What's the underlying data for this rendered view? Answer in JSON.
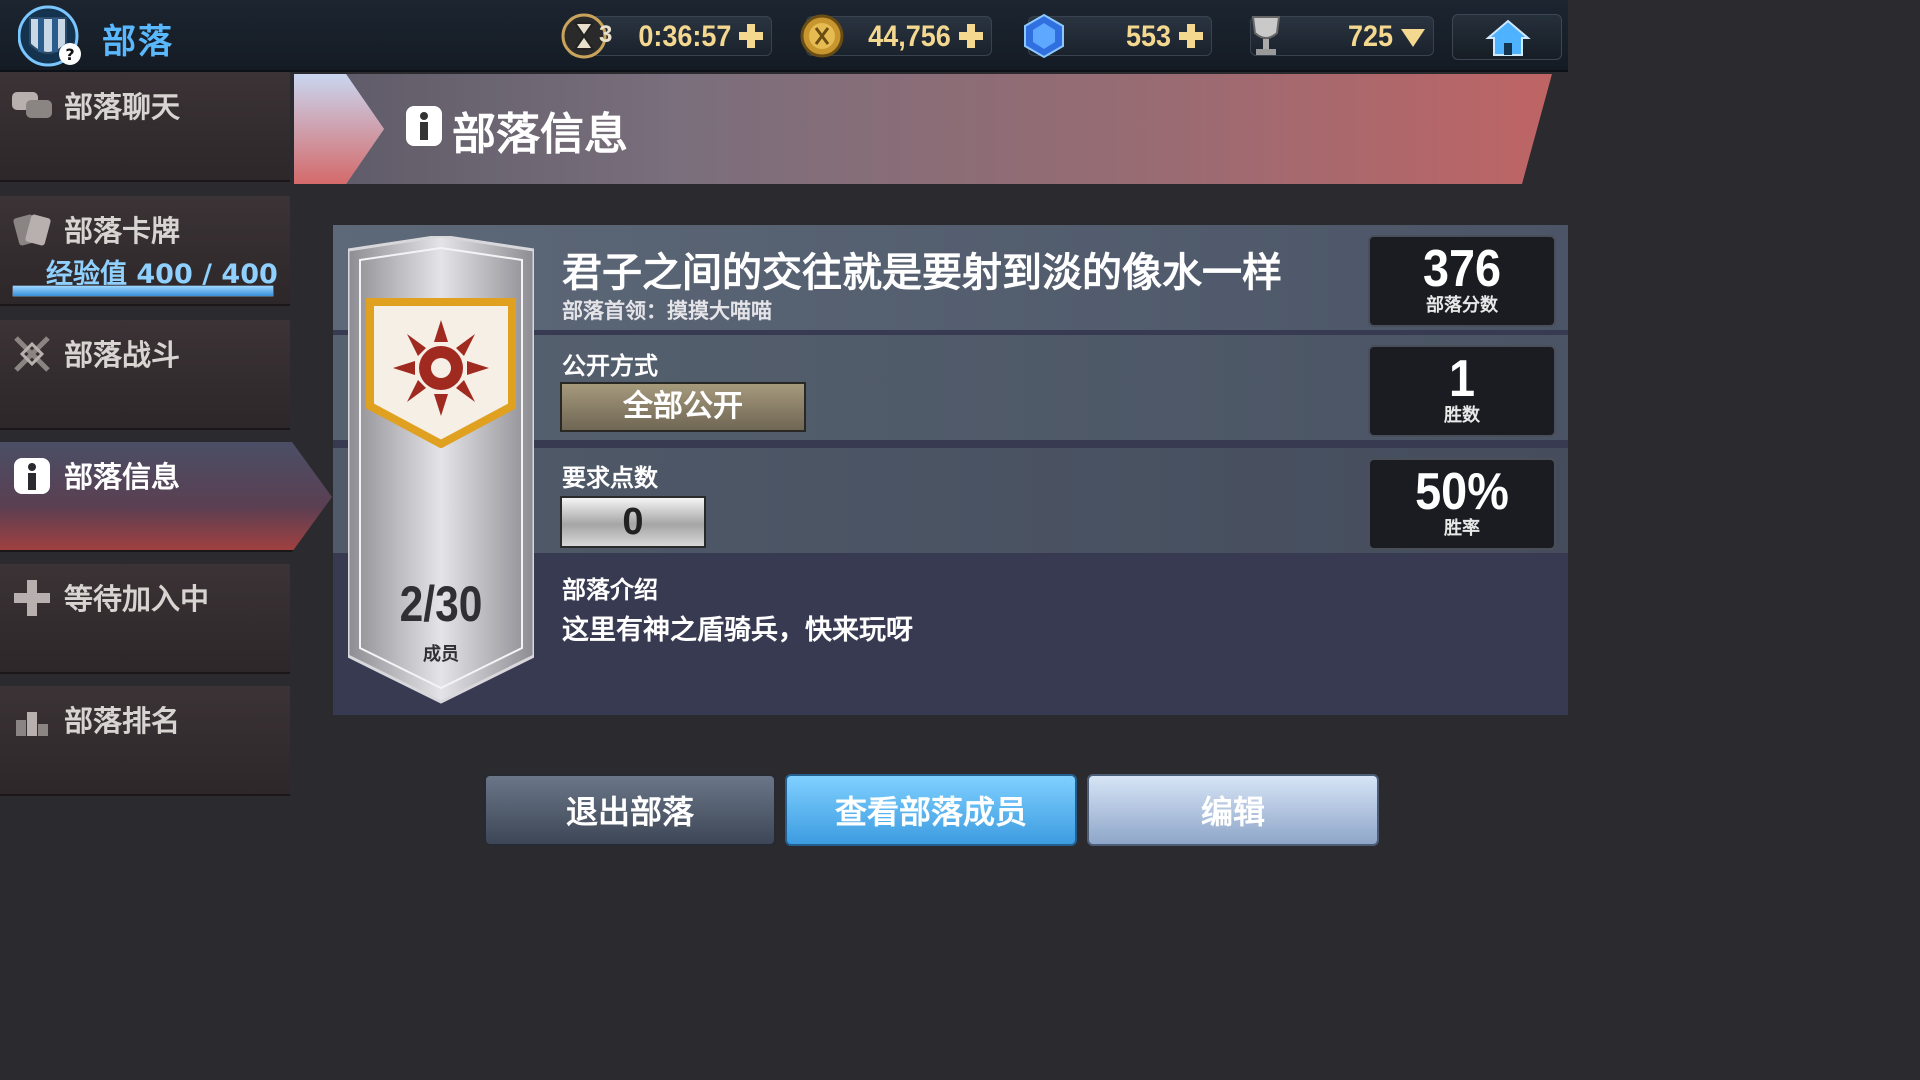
{
  "topbar": {
    "title": "部落",
    "timer_count": "3",
    "timer": "0:36:57",
    "gold": "44,756",
    "gems": "553",
    "trophies": "725",
    "icons": [
      "hourglass-icon",
      "gold-coin-icon",
      "blue-gem-icon",
      "trophy-icon",
      "home-icon"
    ]
  },
  "sidebar": {
    "items": [
      {
        "label": "部落聊天",
        "icon": "chat-bubbles-icon"
      },
      {
        "label": "部落卡牌",
        "icon": "cards-icon"
      },
      {
        "label": "部落战斗",
        "icon": "crossed-swords-icon"
      },
      {
        "label": "部落信息",
        "icon": "info-icon"
      },
      {
        "label": "等待加入中",
        "icon": "plus-icon"
      },
      {
        "label": "部落排名",
        "icon": "podium-icon"
      }
    ],
    "active_index": 3,
    "exp": {
      "label": "经验值 400 / 400",
      "fraction": 1.0
    }
  },
  "header": {
    "title": "部落信息"
  },
  "clan": {
    "name": "君子之间的交往就是要射到淡的像水一样",
    "leader": "部落首领：摸摸大喵喵",
    "open_label": "公开方式",
    "open_value": "全部公开",
    "req_label": "要求点数",
    "req_value": "0",
    "intro_label": "部落介绍",
    "intro_text": "这里有神之盾骑兵，快来玩呀",
    "members": "2/30",
    "members_label": "成员"
  },
  "stats": [
    {
      "value": "376",
      "label": "部落分数"
    },
    {
      "value": "1",
      "label": "胜数"
    },
    {
      "value": "50%",
      "label": "胜率"
    }
  ],
  "buttons": {
    "leave": "退出部落",
    "members": "查看部落成员",
    "edit": "编辑"
  },
  "colors": {
    "accent_blue": "#5ab8ff",
    "gold_text": "#f4d890",
    "active_tab_red": "#a04040"
  }
}
